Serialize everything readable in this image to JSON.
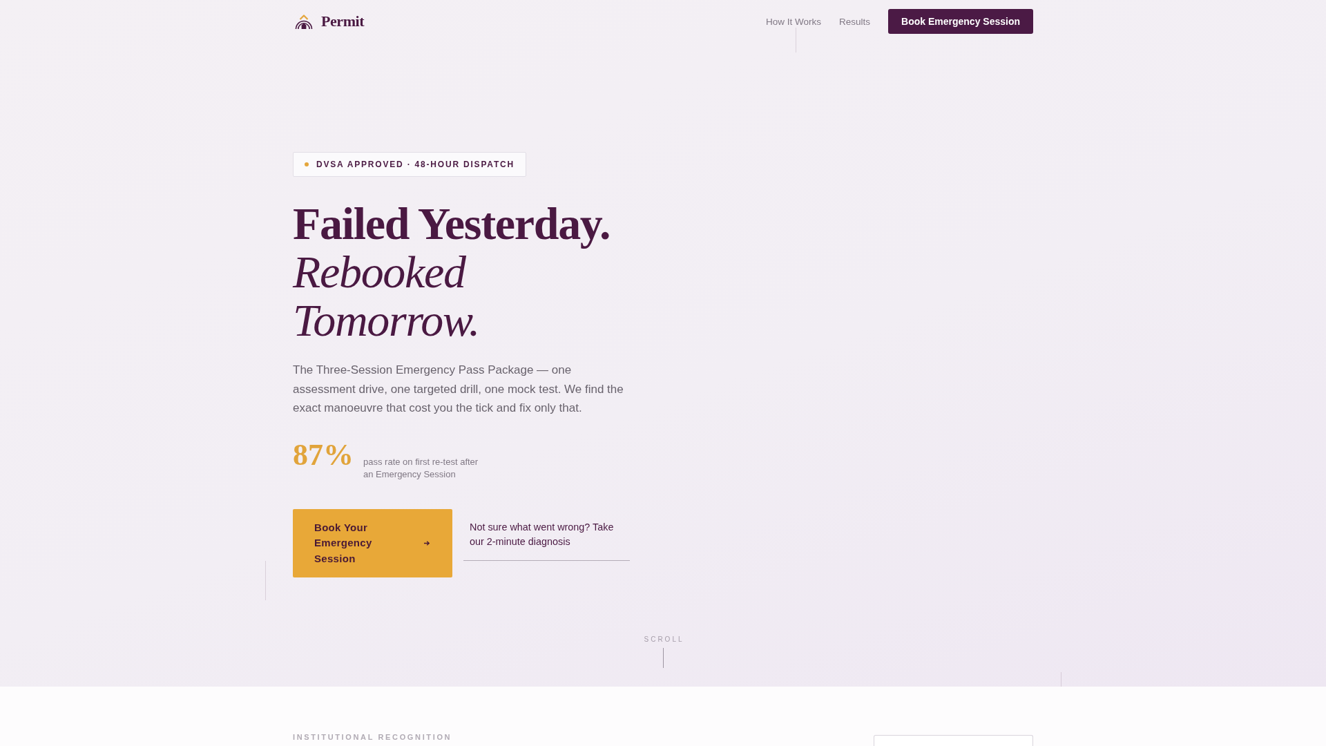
{
  "header": {
    "brand": "Permit",
    "nav": [
      {
        "label": "How It Works"
      },
      {
        "label": "Results"
      }
    ],
    "button": "Book Emergency Session"
  },
  "hero": {
    "badge": "DVSA APPROVED · 48-HOUR DISPATCH",
    "headline": [
      {
        "text": "Failed Yesterday.",
        "kind": "bold"
      },
      {
        "text": "Rebooked Tomorrow.",
        "kind": "italic"
      }
    ],
    "description": "The Three-Session Emergency Pass Package — one assessment drive, one targeted drill, one mock test. We find the exact manoeuvre that cost you the tick and fix only that.",
    "stat": {
      "value": "87%",
      "label": "pass rate on first re-test after an Emergency Session"
    },
    "primary_button": "Book Your Emergency Session",
    "secondary_link": "Not sure what went wrong? Take our 2-minute diagnosis",
    "scroll_hint": "SCROLL"
  },
  "recognition": {
    "eyebrow": "INSTITUTIONAL RECOGNITION"
  }
}
